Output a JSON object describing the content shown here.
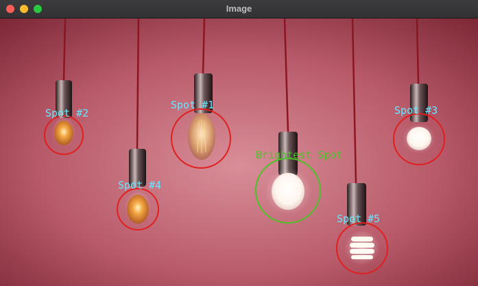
{
  "window": {
    "title": "Image",
    "buttons": {
      "close": "close-button",
      "minimize": "minimize-button",
      "maximize": "maximize-button"
    }
  },
  "colors": {
    "background": "#b85a6a",
    "cord": "#8a1620",
    "spot_circle": "#e0201e",
    "spot_label": "#66e8ff",
    "brightest": "#4ec02a"
  },
  "spots": [
    {
      "id": "spot-1",
      "label": "Spot #1"
    },
    {
      "id": "spot-2",
      "label": "Spot #2"
    },
    {
      "id": "spot-3",
      "label": "Spot #3"
    },
    {
      "id": "spot-4",
      "label": "Spot #4"
    },
    {
      "id": "spot-5",
      "label": "Spot #5"
    }
  ],
  "brightest": {
    "label": "Brightest Spot"
  }
}
